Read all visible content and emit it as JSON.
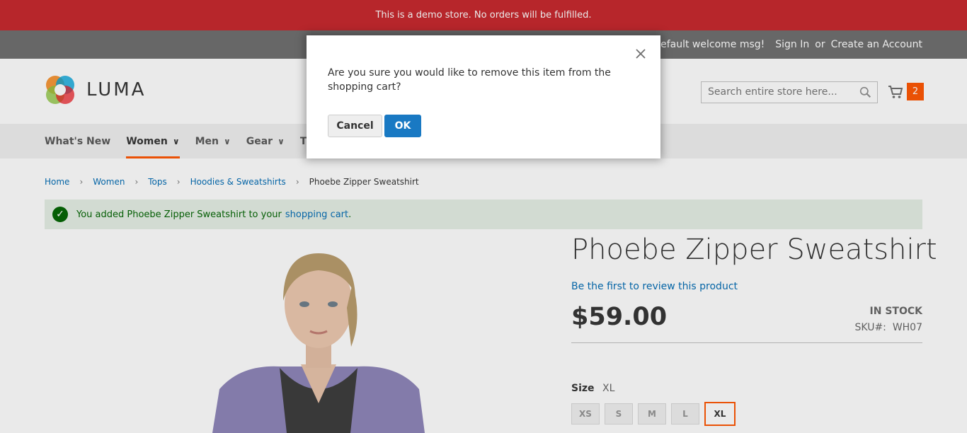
{
  "demo_notice": "This is a demo store. No orders will be fulfilled.",
  "header_links": {
    "welcome": "Default welcome msg!",
    "sign_in": "Sign In",
    "or": "or",
    "create_account": "Create an Account"
  },
  "logo": {
    "text": "LUMA",
    "icon": "luma-logo-icon"
  },
  "search": {
    "placeholder": "Search entire store here...",
    "icon": "search-icon"
  },
  "cart": {
    "count": "2",
    "icon": "cart-icon",
    "accent": "#ff5501"
  },
  "nav": {
    "items": [
      {
        "label": "What's New"
      },
      {
        "label": "Women"
      },
      {
        "label": "Men"
      },
      {
        "label": "Gear"
      },
      {
        "label": "Tr"
      }
    ]
  },
  "breadcrumbs": {
    "items": [
      "Home",
      "Women",
      "Tops",
      "Hoodies & Sweatshirts"
    ],
    "current": "Phoebe Zipper Sweatshirt"
  },
  "message": {
    "prefix": "You added Phoebe Zipper Sweatshirt to your",
    "link": "shopping cart",
    "suffix": "."
  },
  "product": {
    "title": "Phoebe Zipper Sweatshirt",
    "review_link": "Be the first to review this product",
    "price": "$59.00",
    "stock": "IN STOCK",
    "sku_label": "SKU#:",
    "sku": "WH07",
    "size_label": "Size",
    "size_value": "XL",
    "sizes": [
      "XS",
      "S",
      "M",
      "L",
      "XL"
    ]
  },
  "modal": {
    "text": "Are you sure you would like to remove this item from the shopping cart?",
    "cancel": "Cancel",
    "ok": "OK",
    "close_icon": "close-icon"
  },
  "colors": {
    "demo_bar": "#c7252b",
    "accent": "#ff5501",
    "link": "#006bb4",
    "primary_button": "#1979c3"
  }
}
